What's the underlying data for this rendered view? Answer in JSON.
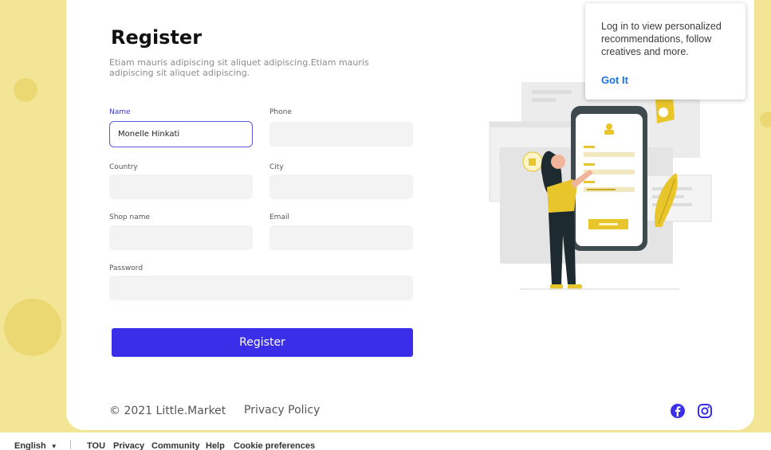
{
  "form": {
    "title": "Register",
    "subtitle": "Etiam mauris adipiscing sit aliquet adipiscing.Etiam mauris adipiscing sit aliquet adipiscing.",
    "name_label": "Name",
    "name_value": "Monelle Hinkati",
    "phone_label": "Phone",
    "country_label": "Country",
    "city_label": "City",
    "shop_label": "Shop name",
    "email_label": "Email",
    "password_label": "Password",
    "submit_label": "Register"
  },
  "footer": {
    "copyright": "© 2021 Little.Market",
    "privacy": "Privacy Policy",
    "social_icons": [
      "facebook-icon",
      "instagram-icon"
    ],
    "social_color": "#3a2ee8"
  },
  "popup": {
    "message": "Log in to view personalized recommendations, follow creatives and more.",
    "button": "Got It"
  },
  "bottom_bar": {
    "language": "English",
    "links": [
      "TOU",
      "Privacy",
      "Community",
      "Help",
      "Cookie preferences"
    ]
  },
  "colors": {
    "accent": "#3a2ee8",
    "background": "#f3e596",
    "illustration_yellow": "#e8c52a"
  }
}
